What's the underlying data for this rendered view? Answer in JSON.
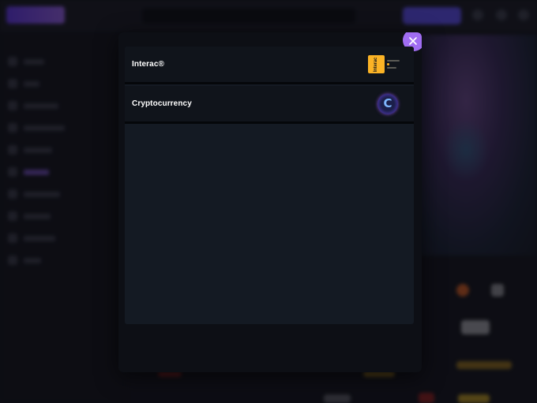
{
  "payment_modal": {
    "methods": [
      {
        "label": "Interac®",
        "logo": "interac-logo",
        "logo_text": "Interac"
      },
      {
        "label": "Cryptocurrency",
        "logo": "crypto-logo",
        "logo_text": "C"
      }
    ],
    "close_icon": "close-icon"
  },
  "colors": {
    "accent": "#a06df2",
    "modal_bg": "#0d0f15",
    "row_bg": "#10141b",
    "interac_yellow": "#fbb325"
  }
}
